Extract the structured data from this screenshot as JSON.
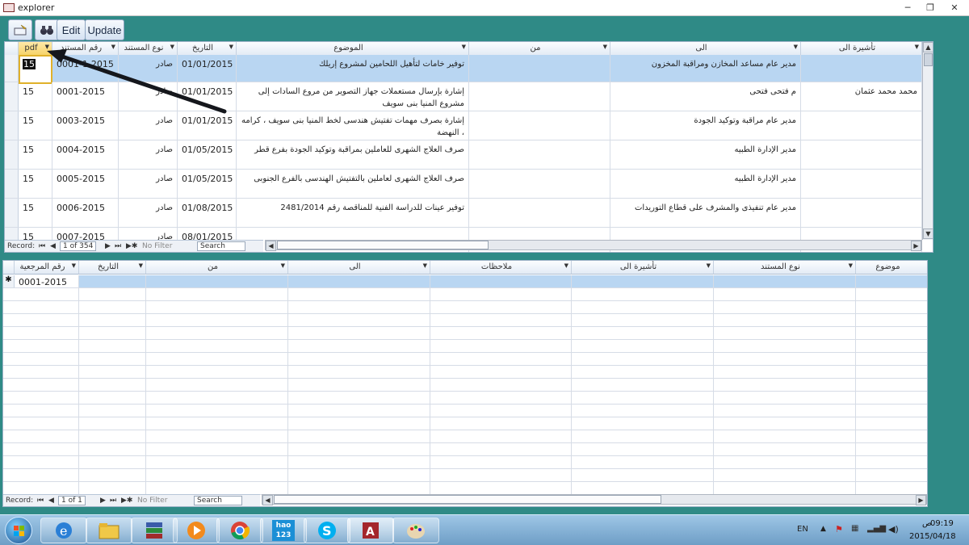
{
  "window": {
    "title": "explorer",
    "min_glyph": "─",
    "restore_glyph": "❐",
    "close_glyph": "✕"
  },
  "toolbar": {
    "binoculars_glyph": "🔍",
    "edit_label": "Edit",
    "update_label": "Update"
  },
  "main_grid": {
    "columns": [
      {
        "key": "pdf",
        "label": "pdf"
      },
      {
        "key": "ref",
        "label": "رقم المستند"
      },
      {
        "key": "doctype",
        "label": "نوع المستند"
      },
      {
        "key": "date",
        "label": "التاريخ"
      },
      {
        "key": "subject",
        "label": "الموضوع"
      },
      {
        "key": "from",
        "label": "من"
      },
      {
        "key": "to",
        "label": "الى"
      },
      {
        "key": "sign",
        "label": "تأشيرة الى"
      }
    ],
    "rows": [
      {
        "pdf": "15",
        "ref": "0001-1-2015",
        "doctype": "صادر",
        "date": "01/01/2015",
        "subject": "توفير خامات لتأهيل اللحامين لمشروع إريلك",
        "from": "",
        "to": "مدير عام مساعد المخازن ومراقبة المخزون",
        "sign": ""
      },
      {
        "pdf": "15",
        "ref": "0001-2015",
        "doctype": "صادر",
        "date": "01/01/2015",
        "subject": "إشارة بإرسال مستعملات جهاز التصوير من مروع السادات إلى مشروع المنيا بنى سويف",
        "from": "",
        "to": "م فتحى فتحى",
        "sign": "محمد محمد عثمان"
      },
      {
        "pdf": "15",
        "ref": "0003-2015",
        "doctype": "صادر",
        "date": "01/01/2015",
        "subject": "إشارة بصرف مهمات تفتيش هندسى لخط المنيا بنى سويف ، كرامه ، النهضة",
        "from": "",
        "to": "مدير عام مراقبة وتوكيد الجودة",
        "sign": ""
      },
      {
        "pdf": "15",
        "ref": "0004-2015",
        "doctype": "صادر",
        "date": "01/05/2015",
        "subject": "صرف العلاج الشهرى للعاملين بمراقبة وتوكيد الجودة بفرع قطر",
        "from": "",
        "to": "مدير الإدارة الطبيه",
        "sign": ""
      },
      {
        "pdf": "15",
        "ref": "0005-2015",
        "doctype": "صادر",
        "date": "01/05/2015",
        "subject": "صرف العلاج الشهرى لعاملين بالتفتيش الهندسى بالفرع الجنوبى",
        "from": "",
        "to": "مدير الإدارة الطبيه",
        "sign": ""
      },
      {
        "pdf": "15",
        "ref": "0006-2015",
        "doctype": "صادر",
        "date": "01/08/2015",
        "subject": "توفير عينات للدراسة الفنية للمناقصة رقم 2481/2014",
        "from": "",
        "to": "مدير عام تنفيذى والمشرف على قطاع التوريدات",
        "sign": ""
      },
      {
        "pdf": "15",
        "ref": "0007-2015",
        "doctype": "صادر",
        "date": "08/01/2015",
        "subject": "",
        "from": "",
        "to": "",
        "sign": ""
      }
    ],
    "nav": {
      "record_label": "Record:",
      "position": "1 of 354",
      "filter_label": "No Filter",
      "search_label": "Search"
    }
  },
  "sub_grid": {
    "columns": [
      {
        "key": "refno",
        "label": "رقم المرجعية"
      },
      {
        "key": "date",
        "label": "التاريخ"
      },
      {
        "key": "from",
        "label": "من"
      },
      {
        "key": "to",
        "label": "الى"
      },
      {
        "key": "notes",
        "label": "ملاحظات"
      },
      {
        "key": "sign",
        "label": "تأشيرة الى"
      },
      {
        "key": "doctype",
        "label": "نوع المستند"
      },
      {
        "key": "subject",
        "label": "موضوع"
      }
    ],
    "new_row": {
      "marker": "✱",
      "refno": "0001-2015"
    },
    "nav": {
      "record_label": "Record:",
      "position": "1 of 1",
      "filter_label": "No Filter",
      "search_label": "Search"
    }
  },
  "taskbar": {
    "apps": [
      "windows-start",
      "internet-explorer",
      "file-explorer",
      "winrar",
      "media-player",
      "chrome",
      "hao123",
      "skype",
      "access",
      "paint"
    ],
    "hao123_text": "hao\n123",
    "language": "EN",
    "clock_ampm": "ص",
    "clock_time": "09:19",
    "clock_date": "2015/04/18"
  }
}
